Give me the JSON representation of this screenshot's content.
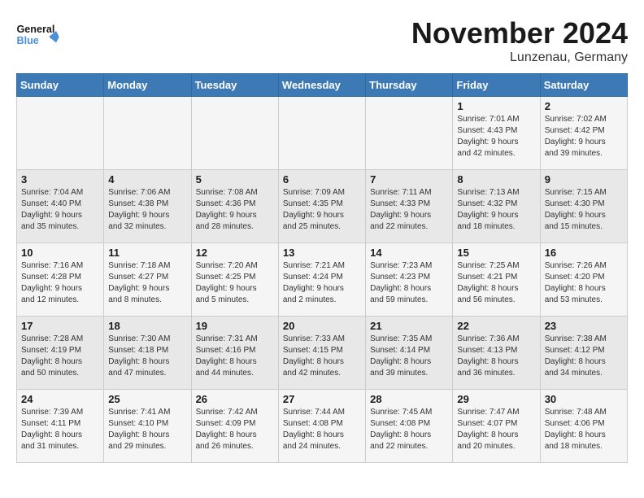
{
  "header": {
    "logo_general": "General",
    "logo_blue": "Blue",
    "month_title": "November 2024",
    "location": "Lunzenau, Germany"
  },
  "weekdays": [
    "Sunday",
    "Monday",
    "Tuesday",
    "Wednesday",
    "Thursday",
    "Friday",
    "Saturday"
  ],
  "weeks": [
    [
      {
        "day": "",
        "info": ""
      },
      {
        "day": "",
        "info": ""
      },
      {
        "day": "",
        "info": ""
      },
      {
        "day": "",
        "info": ""
      },
      {
        "day": "",
        "info": ""
      },
      {
        "day": "1",
        "info": "Sunrise: 7:01 AM\nSunset: 4:43 PM\nDaylight: 9 hours\nand 42 minutes."
      },
      {
        "day": "2",
        "info": "Sunrise: 7:02 AM\nSunset: 4:42 PM\nDaylight: 9 hours\nand 39 minutes."
      }
    ],
    [
      {
        "day": "3",
        "info": "Sunrise: 7:04 AM\nSunset: 4:40 PM\nDaylight: 9 hours\nand 35 minutes."
      },
      {
        "day": "4",
        "info": "Sunrise: 7:06 AM\nSunset: 4:38 PM\nDaylight: 9 hours\nand 32 minutes."
      },
      {
        "day": "5",
        "info": "Sunrise: 7:08 AM\nSunset: 4:36 PM\nDaylight: 9 hours\nand 28 minutes."
      },
      {
        "day": "6",
        "info": "Sunrise: 7:09 AM\nSunset: 4:35 PM\nDaylight: 9 hours\nand 25 minutes."
      },
      {
        "day": "7",
        "info": "Sunrise: 7:11 AM\nSunset: 4:33 PM\nDaylight: 9 hours\nand 22 minutes."
      },
      {
        "day": "8",
        "info": "Sunrise: 7:13 AM\nSunset: 4:32 PM\nDaylight: 9 hours\nand 18 minutes."
      },
      {
        "day": "9",
        "info": "Sunrise: 7:15 AM\nSunset: 4:30 PM\nDaylight: 9 hours\nand 15 minutes."
      }
    ],
    [
      {
        "day": "10",
        "info": "Sunrise: 7:16 AM\nSunset: 4:28 PM\nDaylight: 9 hours\nand 12 minutes."
      },
      {
        "day": "11",
        "info": "Sunrise: 7:18 AM\nSunset: 4:27 PM\nDaylight: 9 hours\nand 8 minutes."
      },
      {
        "day": "12",
        "info": "Sunrise: 7:20 AM\nSunset: 4:25 PM\nDaylight: 9 hours\nand 5 minutes."
      },
      {
        "day": "13",
        "info": "Sunrise: 7:21 AM\nSunset: 4:24 PM\nDaylight: 9 hours\nand 2 minutes."
      },
      {
        "day": "14",
        "info": "Sunrise: 7:23 AM\nSunset: 4:23 PM\nDaylight: 8 hours\nand 59 minutes."
      },
      {
        "day": "15",
        "info": "Sunrise: 7:25 AM\nSunset: 4:21 PM\nDaylight: 8 hours\nand 56 minutes."
      },
      {
        "day": "16",
        "info": "Sunrise: 7:26 AM\nSunset: 4:20 PM\nDaylight: 8 hours\nand 53 minutes."
      }
    ],
    [
      {
        "day": "17",
        "info": "Sunrise: 7:28 AM\nSunset: 4:19 PM\nDaylight: 8 hours\nand 50 minutes."
      },
      {
        "day": "18",
        "info": "Sunrise: 7:30 AM\nSunset: 4:18 PM\nDaylight: 8 hours\nand 47 minutes."
      },
      {
        "day": "19",
        "info": "Sunrise: 7:31 AM\nSunset: 4:16 PM\nDaylight: 8 hours\nand 44 minutes."
      },
      {
        "day": "20",
        "info": "Sunrise: 7:33 AM\nSunset: 4:15 PM\nDaylight: 8 hours\nand 42 minutes."
      },
      {
        "day": "21",
        "info": "Sunrise: 7:35 AM\nSunset: 4:14 PM\nDaylight: 8 hours\nand 39 minutes."
      },
      {
        "day": "22",
        "info": "Sunrise: 7:36 AM\nSunset: 4:13 PM\nDaylight: 8 hours\nand 36 minutes."
      },
      {
        "day": "23",
        "info": "Sunrise: 7:38 AM\nSunset: 4:12 PM\nDaylight: 8 hours\nand 34 minutes."
      }
    ],
    [
      {
        "day": "24",
        "info": "Sunrise: 7:39 AM\nSunset: 4:11 PM\nDaylight: 8 hours\nand 31 minutes."
      },
      {
        "day": "25",
        "info": "Sunrise: 7:41 AM\nSunset: 4:10 PM\nDaylight: 8 hours\nand 29 minutes."
      },
      {
        "day": "26",
        "info": "Sunrise: 7:42 AM\nSunset: 4:09 PM\nDaylight: 8 hours\nand 26 minutes."
      },
      {
        "day": "27",
        "info": "Sunrise: 7:44 AM\nSunset: 4:08 PM\nDaylight: 8 hours\nand 24 minutes."
      },
      {
        "day": "28",
        "info": "Sunrise: 7:45 AM\nSunset: 4:08 PM\nDaylight: 8 hours\nand 22 minutes."
      },
      {
        "day": "29",
        "info": "Sunrise: 7:47 AM\nSunset: 4:07 PM\nDaylight: 8 hours\nand 20 minutes."
      },
      {
        "day": "30",
        "info": "Sunrise: 7:48 AM\nSunset: 4:06 PM\nDaylight: 8 hours\nand 18 minutes."
      }
    ]
  ]
}
